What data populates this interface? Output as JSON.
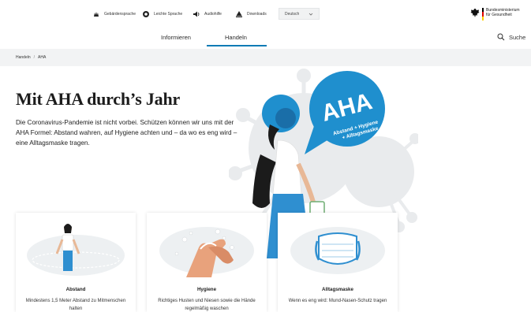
{
  "utility": {
    "items": [
      {
        "label": "Gebärdensprache",
        "icon": "sign-language-icon"
      },
      {
        "label": "Leichte Sprache",
        "icon": "easy-language-icon"
      },
      {
        "label": "Audiohilfe",
        "icon": "speaker-icon"
      },
      {
        "label": "Downloads",
        "icon": "download-icon"
      }
    ],
    "language": "Deutsch"
  },
  "brand": {
    "line1": "Bundesministerium",
    "line2": "für Gesundheit"
  },
  "nav": {
    "tabs": [
      {
        "label": "Informieren",
        "active": false
      },
      {
        "label": "Handeln",
        "active": true
      }
    ],
    "search_label": "Suche"
  },
  "breadcrumb": {
    "items": [
      "Handeln",
      "AHA"
    ],
    "separator": "/"
  },
  "hero": {
    "title": "Mit AHA durch’s Jahr",
    "text": "Die Coronavirus-Pandemie ist nicht vorbei. Schützen können wir uns mit der AHA Formel: Abstand wahren, auf Hygiene achten und – da wo es eng wird – eine Alltagsmaske tragen.",
    "bubble_big": "AHA",
    "bubble_line1": "Abstand + Hygiene",
    "bubble_line2": "+ Alltagsmaske"
  },
  "cards": [
    {
      "title": "Abstand",
      "text": "Mindestens 1,5 Meter Abstand zu Mitmenschen halten"
    },
    {
      "title": "Hygiene",
      "text": "Richtiges Husten und Niesen sowie die Hände regelmäßig waschen"
    },
    {
      "title": "Alltagsmaske",
      "text": "Wenn es eng wird: Mund-Nasen-Schutz tragen"
    }
  ],
  "colors": {
    "accent": "#0a7bb5",
    "bubble": "#1f8fce",
    "virus": "#e9ebed",
    "card_bg": "#edf0f2"
  }
}
